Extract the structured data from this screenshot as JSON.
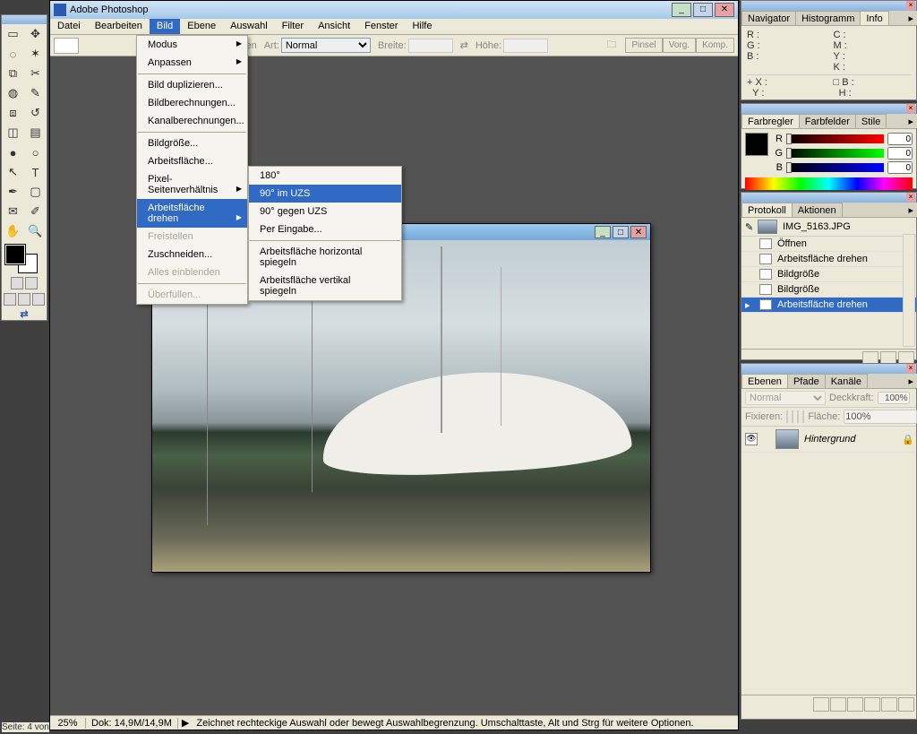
{
  "app": {
    "title": "Adobe Photoshop"
  },
  "menubar": [
    "Datei",
    "Bearbeiten",
    "Bild",
    "Ebene",
    "Auswahl",
    "Filter",
    "Ansicht",
    "Fenster",
    "Hilfe"
  ],
  "menubar_active": 2,
  "optionbar": {
    "glatten": "Glätten",
    "art": "Art:",
    "art_value": "Normal",
    "breite": "Breite:",
    "hoehe": "Höhe:",
    "brush_tabs": [
      "Pinsel",
      "Vorg.",
      "Komp."
    ]
  },
  "menu_bild": {
    "groups": [
      [
        {
          "label": "Modus",
          "arrow": true
        },
        {
          "label": "Anpassen",
          "arrow": true
        }
      ],
      [
        {
          "label": "Bild duplizieren..."
        },
        {
          "label": "Bildberechnungen..."
        },
        {
          "label": "Kanalberechnungen..."
        }
      ],
      [
        {
          "label": "Bildgröße..."
        },
        {
          "label": "Arbeitsfläche..."
        },
        {
          "label": "Pixel-Seitenverhältnis",
          "arrow": true
        },
        {
          "label": "Arbeitsfläche drehen",
          "arrow": true,
          "highlight": true
        },
        {
          "label": "Freistellen",
          "disabled": true
        },
        {
          "label": "Zuschneiden..."
        },
        {
          "label": "Alles einblenden",
          "disabled": true
        }
      ],
      [
        {
          "label": "Überfüllen...",
          "disabled": true
        }
      ]
    ]
  },
  "menu_drehen": [
    {
      "label": "180°"
    },
    {
      "label": "90° im UZS",
      "highlight": true
    },
    {
      "label": "90° gegen UZS"
    },
    {
      "label": "Per Eingabe..."
    },
    {
      "sep": true
    },
    {
      "label": "Arbeitsfläche horizontal spiegeln"
    },
    {
      "label": "Arbeitsfläche vertikal spiegeln"
    }
  ],
  "status": {
    "zoom": "25%",
    "doc": "Dok: 14,9M/14,9M",
    "hint": "Zeichnet rechteckige Auswahl oder bewegt Auswahlbegrenzung. Umschalttaste, Alt und Strg für weitere Optionen.",
    "page": "Seite: 4 von"
  },
  "panels": {
    "info": {
      "tabs": [
        "Navigator",
        "Histogramm",
        "Info"
      ],
      "active": 2,
      "left1": [
        "R :",
        "G :",
        "B :"
      ],
      "right1": [
        "C :",
        "M :",
        "Y :",
        "K :"
      ],
      "left2": [
        "X :",
        "Y :"
      ],
      "right2": [
        "B :",
        "H :"
      ]
    },
    "color": {
      "tabs": [
        "Farbregler",
        "Farbfelder",
        "Stile"
      ],
      "active": 0,
      "r": 0,
      "g": 0,
      "b": 0
    },
    "history": {
      "tabs": [
        "Protokoll",
        "Aktionen"
      ],
      "active": 0,
      "docname": "IMG_5163.JPG",
      "items": [
        {
          "label": "Öffnen"
        },
        {
          "label": "Arbeitsfläche drehen"
        },
        {
          "label": "Bildgröße"
        },
        {
          "label": "Bildgröße"
        },
        {
          "label": "Arbeitsfläche drehen",
          "sel": true
        }
      ]
    },
    "layers": {
      "tabs": [
        "Ebenen",
        "Pfade",
        "Kanäle"
      ],
      "active": 0,
      "blend": "Normal",
      "opacity_label": "Deckkraft:",
      "opacity": "100%",
      "fill_label": "Fläche:",
      "fill": "100%",
      "lock_label": "Fixieren:",
      "layer": {
        "name": "Hintergrund"
      }
    }
  }
}
